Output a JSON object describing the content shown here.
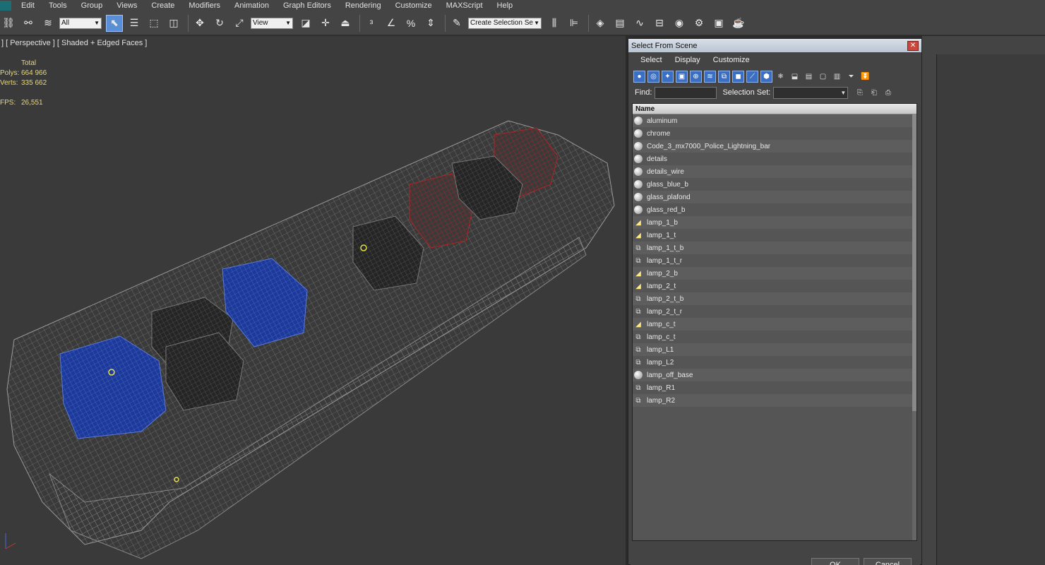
{
  "menu": [
    "Edit",
    "Tools",
    "Group",
    "Views",
    "Create",
    "Modifiers",
    "Animation",
    "Graph Editors",
    "Rendering",
    "Customize",
    "MAXScript",
    "Help"
  ],
  "toolbar": {
    "filter_value": "All",
    "ref_coord_value": "View",
    "selection_set_placeholder": "Create Selection Se"
  },
  "viewport": {
    "label": "] [ Perspective ] [ Shaded + Edged Faces ]",
    "stats": {
      "header": "Total",
      "polys_label": "Polys:",
      "polys_value": "664 966",
      "verts_label": "Verts:",
      "verts_value": "335 662",
      "fps_label": "FPS:",
      "fps_value": "26,551"
    }
  },
  "dialog": {
    "title": "Select From Scene",
    "close_glyph": "✕",
    "menu": [
      "Select",
      "Display",
      "Customize"
    ],
    "find_label": "Find:",
    "selection_set_label": "Selection Set:",
    "column_name": "Name",
    "ok_label": "OK",
    "cancel_label": "Cancel",
    "items": [
      {
        "name": "aluminum",
        "icon": "sphere"
      },
      {
        "name": "chrome",
        "icon": "sphere"
      },
      {
        "name": "Code_3_mx7000_Police_Lightning_bar",
        "icon": "sphere"
      },
      {
        "name": "details",
        "icon": "sphere"
      },
      {
        "name": "details_wire",
        "icon": "sphere"
      },
      {
        "name": "glass_blue_b",
        "icon": "sphere"
      },
      {
        "name": "glass_plafond",
        "icon": "sphere"
      },
      {
        "name": "glass_red_b",
        "icon": "sphere"
      },
      {
        "name": "lamp_1_b",
        "icon": "light"
      },
      {
        "name": "lamp_1_t",
        "icon": "light"
      },
      {
        "name": "lamp_1_t_b",
        "icon": "mesh"
      },
      {
        "name": "lamp_1_t_r",
        "icon": "mesh"
      },
      {
        "name": "lamp_2_b",
        "icon": "light"
      },
      {
        "name": "lamp_2_t",
        "icon": "light"
      },
      {
        "name": "lamp_2_t_b",
        "icon": "mesh"
      },
      {
        "name": "lamp_2_t_r",
        "icon": "mesh"
      },
      {
        "name": "lamp_c_t",
        "icon": "light"
      },
      {
        "name": "lamp_c_t",
        "icon": "mesh"
      },
      {
        "name": "lamp_L1",
        "icon": "mesh"
      },
      {
        "name": "lamp_L2",
        "icon": "mesh"
      },
      {
        "name": "lamp_off_base",
        "icon": "sphere"
      },
      {
        "name": "lamp_R1",
        "icon": "mesh"
      },
      {
        "name": "lamp_R2",
        "icon": "mesh"
      }
    ]
  },
  "colors": {
    "stats_text": "#e8d87a",
    "light_red": "#b02424",
    "light_blue": "#1d3a9a",
    "active_button": "#5a8fd6"
  }
}
